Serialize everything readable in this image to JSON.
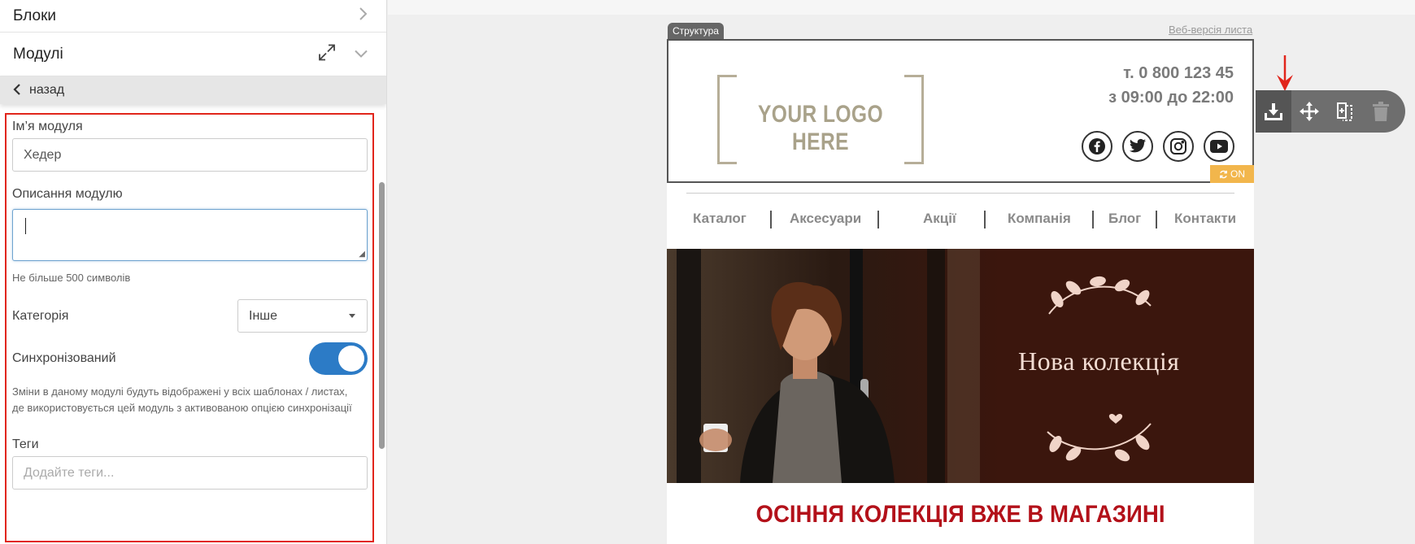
{
  "left_panel": {
    "blocks_title": "Блоки",
    "modules_title": "Модулі",
    "back_label": "назад",
    "form": {
      "module_name_label": "Ім’я модуля",
      "module_name_value": "Хедер",
      "description_label": "Описання модулю",
      "description_hint": "Не більше 500 символів",
      "category_label": "Категорія",
      "category_value": "Інше",
      "synced_label": "Синхронізований",
      "synced_on": true,
      "synced_note": "Зміни в даному модулі будуть відображені у всіх шаблонах / листах, де використовується цей модуль з активованою опцією синхронізації",
      "tags_label": "Теги",
      "tags_placeholder": "Додайте теги..."
    }
  },
  "canvas": {
    "structure_tab": "Структура",
    "web_version_link": "Веб-версія листа",
    "header": {
      "logo_text": "YOUR LOGO HERE",
      "phone_line1": "т. 0 800 123 45",
      "phone_line2": "з 09:00 до 22:00",
      "socials": [
        "facebook-icon",
        "twitter-icon",
        "instagram-icon",
        "youtube-icon"
      ],
      "sync_badge": "ON"
    },
    "nav": [
      "Каталог",
      "Аксесуари",
      "Акції",
      "Компанія",
      "Блог",
      "Контакти"
    ],
    "hero_title": "Нова колекція",
    "headline": "ОСІННЯ КОЛЕКЦІЯ ВЖЕ В МАГАЗИНІ"
  },
  "toolbar": {
    "buttons": [
      "save-module-icon",
      "move-icon",
      "copy-icon",
      "delete-icon"
    ]
  },
  "colors": {
    "accent_blue": "#2c7bc6",
    "highlight_red": "#e1251b",
    "headline_red": "#b3111a",
    "sync_orange": "#f2b64c",
    "hero_bg": "#3b160d"
  }
}
